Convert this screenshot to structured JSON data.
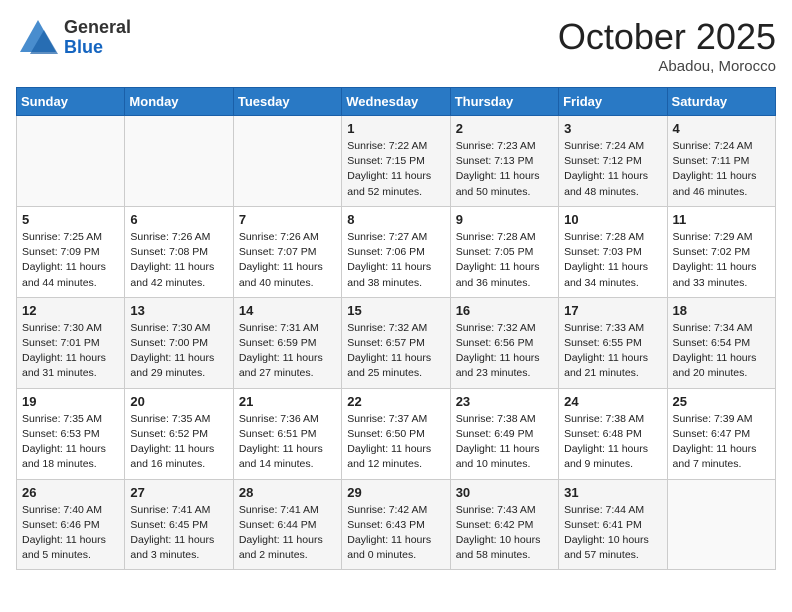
{
  "logo": {
    "general": "General",
    "blue": "Blue"
  },
  "header": {
    "month": "October 2025",
    "location": "Abadou, Morocco"
  },
  "weekdays": [
    "Sunday",
    "Monday",
    "Tuesday",
    "Wednesday",
    "Thursday",
    "Friday",
    "Saturday"
  ],
  "weeks": [
    [
      {
        "day": "",
        "sunrise": "",
        "sunset": "",
        "daylight": ""
      },
      {
        "day": "",
        "sunrise": "",
        "sunset": "",
        "daylight": ""
      },
      {
        "day": "",
        "sunrise": "",
        "sunset": "",
        "daylight": ""
      },
      {
        "day": "1",
        "sunrise": "Sunrise: 7:22 AM",
        "sunset": "Sunset: 7:15 PM",
        "daylight": "Daylight: 11 hours and 52 minutes."
      },
      {
        "day": "2",
        "sunrise": "Sunrise: 7:23 AM",
        "sunset": "Sunset: 7:13 PM",
        "daylight": "Daylight: 11 hours and 50 minutes."
      },
      {
        "day": "3",
        "sunrise": "Sunrise: 7:24 AM",
        "sunset": "Sunset: 7:12 PM",
        "daylight": "Daylight: 11 hours and 48 minutes."
      },
      {
        "day": "4",
        "sunrise": "Sunrise: 7:24 AM",
        "sunset": "Sunset: 7:11 PM",
        "daylight": "Daylight: 11 hours and 46 minutes."
      }
    ],
    [
      {
        "day": "5",
        "sunrise": "Sunrise: 7:25 AM",
        "sunset": "Sunset: 7:09 PM",
        "daylight": "Daylight: 11 hours and 44 minutes."
      },
      {
        "day": "6",
        "sunrise": "Sunrise: 7:26 AM",
        "sunset": "Sunset: 7:08 PM",
        "daylight": "Daylight: 11 hours and 42 minutes."
      },
      {
        "day": "7",
        "sunrise": "Sunrise: 7:26 AM",
        "sunset": "Sunset: 7:07 PM",
        "daylight": "Daylight: 11 hours and 40 minutes."
      },
      {
        "day": "8",
        "sunrise": "Sunrise: 7:27 AM",
        "sunset": "Sunset: 7:06 PM",
        "daylight": "Daylight: 11 hours and 38 minutes."
      },
      {
        "day": "9",
        "sunrise": "Sunrise: 7:28 AM",
        "sunset": "Sunset: 7:05 PM",
        "daylight": "Daylight: 11 hours and 36 minutes."
      },
      {
        "day": "10",
        "sunrise": "Sunrise: 7:28 AM",
        "sunset": "Sunset: 7:03 PM",
        "daylight": "Daylight: 11 hours and 34 minutes."
      },
      {
        "day": "11",
        "sunrise": "Sunrise: 7:29 AM",
        "sunset": "Sunset: 7:02 PM",
        "daylight": "Daylight: 11 hours and 33 minutes."
      }
    ],
    [
      {
        "day": "12",
        "sunrise": "Sunrise: 7:30 AM",
        "sunset": "Sunset: 7:01 PM",
        "daylight": "Daylight: 11 hours and 31 minutes."
      },
      {
        "day": "13",
        "sunrise": "Sunrise: 7:30 AM",
        "sunset": "Sunset: 7:00 PM",
        "daylight": "Daylight: 11 hours and 29 minutes."
      },
      {
        "day": "14",
        "sunrise": "Sunrise: 7:31 AM",
        "sunset": "Sunset: 6:59 PM",
        "daylight": "Daylight: 11 hours and 27 minutes."
      },
      {
        "day": "15",
        "sunrise": "Sunrise: 7:32 AM",
        "sunset": "Sunset: 6:57 PM",
        "daylight": "Daylight: 11 hours and 25 minutes."
      },
      {
        "day": "16",
        "sunrise": "Sunrise: 7:32 AM",
        "sunset": "Sunset: 6:56 PM",
        "daylight": "Daylight: 11 hours and 23 minutes."
      },
      {
        "day": "17",
        "sunrise": "Sunrise: 7:33 AM",
        "sunset": "Sunset: 6:55 PM",
        "daylight": "Daylight: 11 hours and 21 minutes."
      },
      {
        "day": "18",
        "sunrise": "Sunrise: 7:34 AM",
        "sunset": "Sunset: 6:54 PM",
        "daylight": "Daylight: 11 hours and 20 minutes."
      }
    ],
    [
      {
        "day": "19",
        "sunrise": "Sunrise: 7:35 AM",
        "sunset": "Sunset: 6:53 PM",
        "daylight": "Daylight: 11 hours and 18 minutes."
      },
      {
        "day": "20",
        "sunrise": "Sunrise: 7:35 AM",
        "sunset": "Sunset: 6:52 PM",
        "daylight": "Daylight: 11 hours and 16 minutes."
      },
      {
        "day": "21",
        "sunrise": "Sunrise: 7:36 AM",
        "sunset": "Sunset: 6:51 PM",
        "daylight": "Daylight: 11 hours and 14 minutes."
      },
      {
        "day": "22",
        "sunrise": "Sunrise: 7:37 AM",
        "sunset": "Sunset: 6:50 PM",
        "daylight": "Daylight: 11 hours and 12 minutes."
      },
      {
        "day": "23",
        "sunrise": "Sunrise: 7:38 AM",
        "sunset": "Sunset: 6:49 PM",
        "daylight": "Daylight: 11 hours and 10 minutes."
      },
      {
        "day": "24",
        "sunrise": "Sunrise: 7:38 AM",
        "sunset": "Sunset: 6:48 PM",
        "daylight": "Daylight: 11 hours and 9 minutes."
      },
      {
        "day": "25",
        "sunrise": "Sunrise: 7:39 AM",
        "sunset": "Sunset: 6:47 PM",
        "daylight": "Daylight: 11 hours and 7 minutes."
      }
    ],
    [
      {
        "day": "26",
        "sunrise": "Sunrise: 7:40 AM",
        "sunset": "Sunset: 6:46 PM",
        "daylight": "Daylight: 11 hours and 5 minutes."
      },
      {
        "day": "27",
        "sunrise": "Sunrise: 7:41 AM",
        "sunset": "Sunset: 6:45 PM",
        "daylight": "Daylight: 11 hours and 3 minutes."
      },
      {
        "day": "28",
        "sunrise": "Sunrise: 7:41 AM",
        "sunset": "Sunset: 6:44 PM",
        "daylight": "Daylight: 11 hours and 2 minutes."
      },
      {
        "day": "29",
        "sunrise": "Sunrise: 7:42 AM",
        "sunset": "Sunset: 6:43 PM",
        "daylight": "Daylight: 11 hours and 0 minutes."
      },
      {
        "day": "30",
        "sunrise": "Sunrise: 7:43 AM",
        "sunset": "Sunset: 6:42 PM",
        "daylight": "Daylight: 10 hours and 58 minutes."
      },
      {
        "day": "31",
        "sunrise": "Sunrise: 7:44 AM",
        "sunset": "Sunset: 6:41 PM",
        "daylight": "Daylight: 10 hours and 57 minutes."
      },
      {
        "day": "",
        "sunrise": "",
        "sunset": "",
        "daylight": ""
      }
    ]
  ]
}
